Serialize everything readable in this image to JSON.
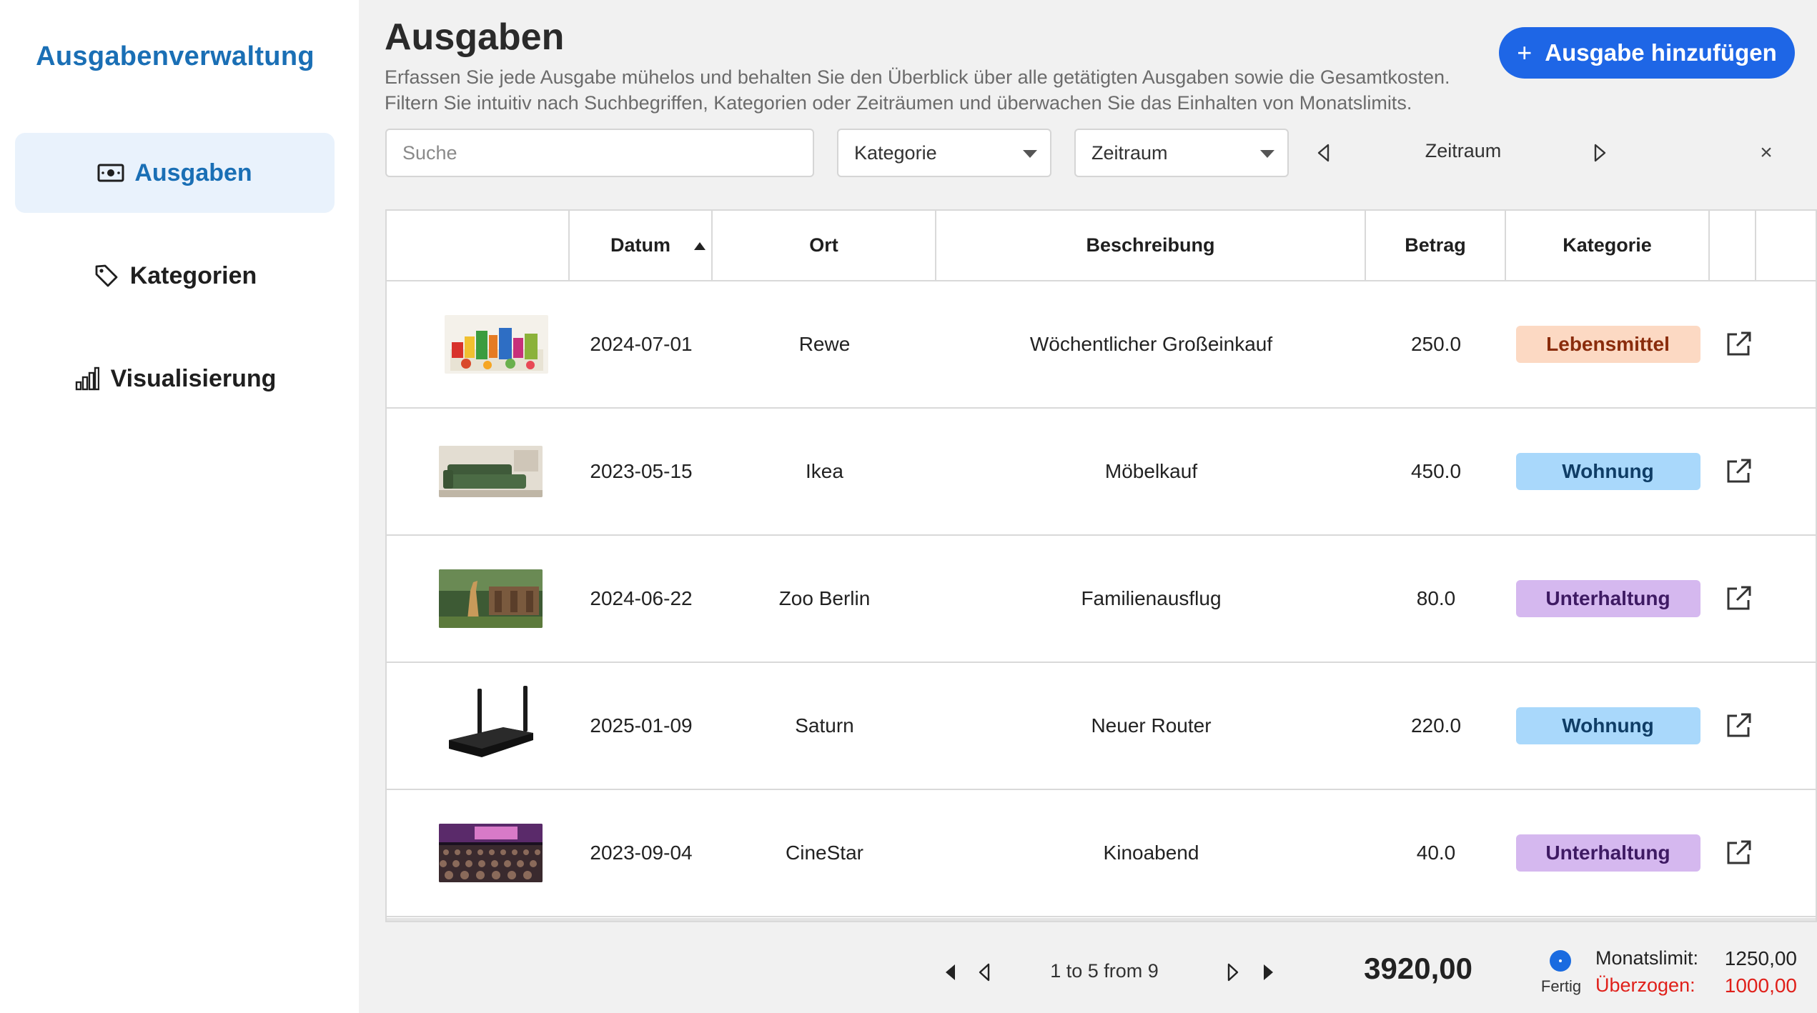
{
  "sidebar": {
    "title": "Ausgabenverwaltung",
    "items": [
      {
        "label": "Ausgaben",
        "icon": "money-icon",
        "active": true
      },
      {
        "label": "Kategorien",
        "icon": "tag-icon",
        "active": false
      },
      {
        "label": "Visualisierung",
        "icon": "bar-chart-icon",
        "active": false
      }
    ]
  },
  "header": {
    "title": "Ausgaben",
    "description_line1": "Erfassen Sie jede Ausgabe mühelos und behalten Sie den Überblick über alle getätigten Ausgaben sowie die Gesamtkosten.",
    "description_line2": "Filtern Sie intuitiv nach Suchbegriffen, Kategorien oder Zeiträumen und überwachen Sie das Einhalten von Monatslimits.",
    "add_button": "Ausgabe hinzufügen",
    "add_button_color": "#1e66e6"
  },
  "filters": {
    "search_placeholder": "Suche",
    "category_select": "Kategorie",
    "period_select": "Zeitraum",
    "period_label": "Zeitraum",
    "clear": "×"
  },
  "table": {
    "columns": [
      "",
      "Datum",
      "Ort",
      "Beschreibung",
      "Betrag",
      "Kategorie",
      ""
    ],
    "sort_column": "Datum",
    "sort_direction": "ascending",
    "rows": [
      {
        "image": "groceries",
        "date": "2024-07-01",
        "place": "Rewe",
        "description": "Wöchentlicher Großeinkauf",
        "amount": "250.0",
        "category": "Lebensmittel"
      },
      {
        "image": "sofa",
        "date": "2023-05-15",
        "place": "Ikea",
        "description": "Möbelkauf",
        "amount": "450.0",
        "category": "Wohnung"
      },
      {
        "image": "zoo",
        "date": "2024-06-22",
        "place": "Zoo Berlin",
        "description": "Familienausflug",
        "amount": "80.0",
        "category": "Unterhaltung"
      },
      {
        "image": "router",
        "date": "2025-01-09",
        "place": "Saturn",
        "description": "Neuer Router",
        "amount": "220.0",
        "category": "Wohnung"
      },
      {
        "image": "cinema",
        "date": "2023-09-04",
        "place": "CineStar",
        "description": "Kinoabend",
        "amount": "40.0",
        "category": "Unterhaltung"
      }
    ],
    "category_colors": {
      "Lebensmittel": {
        "bg": "#fcd9c3",
        "fg": "#8a2c0c"
      },
      "Wohnung": {
        "bg": "#a9d8fb",
        "fg": "#0f3d66"
      },
      "Unterhaltung": {
        "bg": "#d5b8ef",
        "fg": "#3e1a63"
      }
    }
  },
  "footer": {
    "pagination": "1 to 5 from 9",
    "total": "3920,00",
    "status": "Fertig",
    "limit_label": "Monatslimit:",
    "limit_value": "1250,00",
    "over_label": "Überzogen:",
    "over_value": "1000,00",
    "over_color": "#e0201a"
  }
}
